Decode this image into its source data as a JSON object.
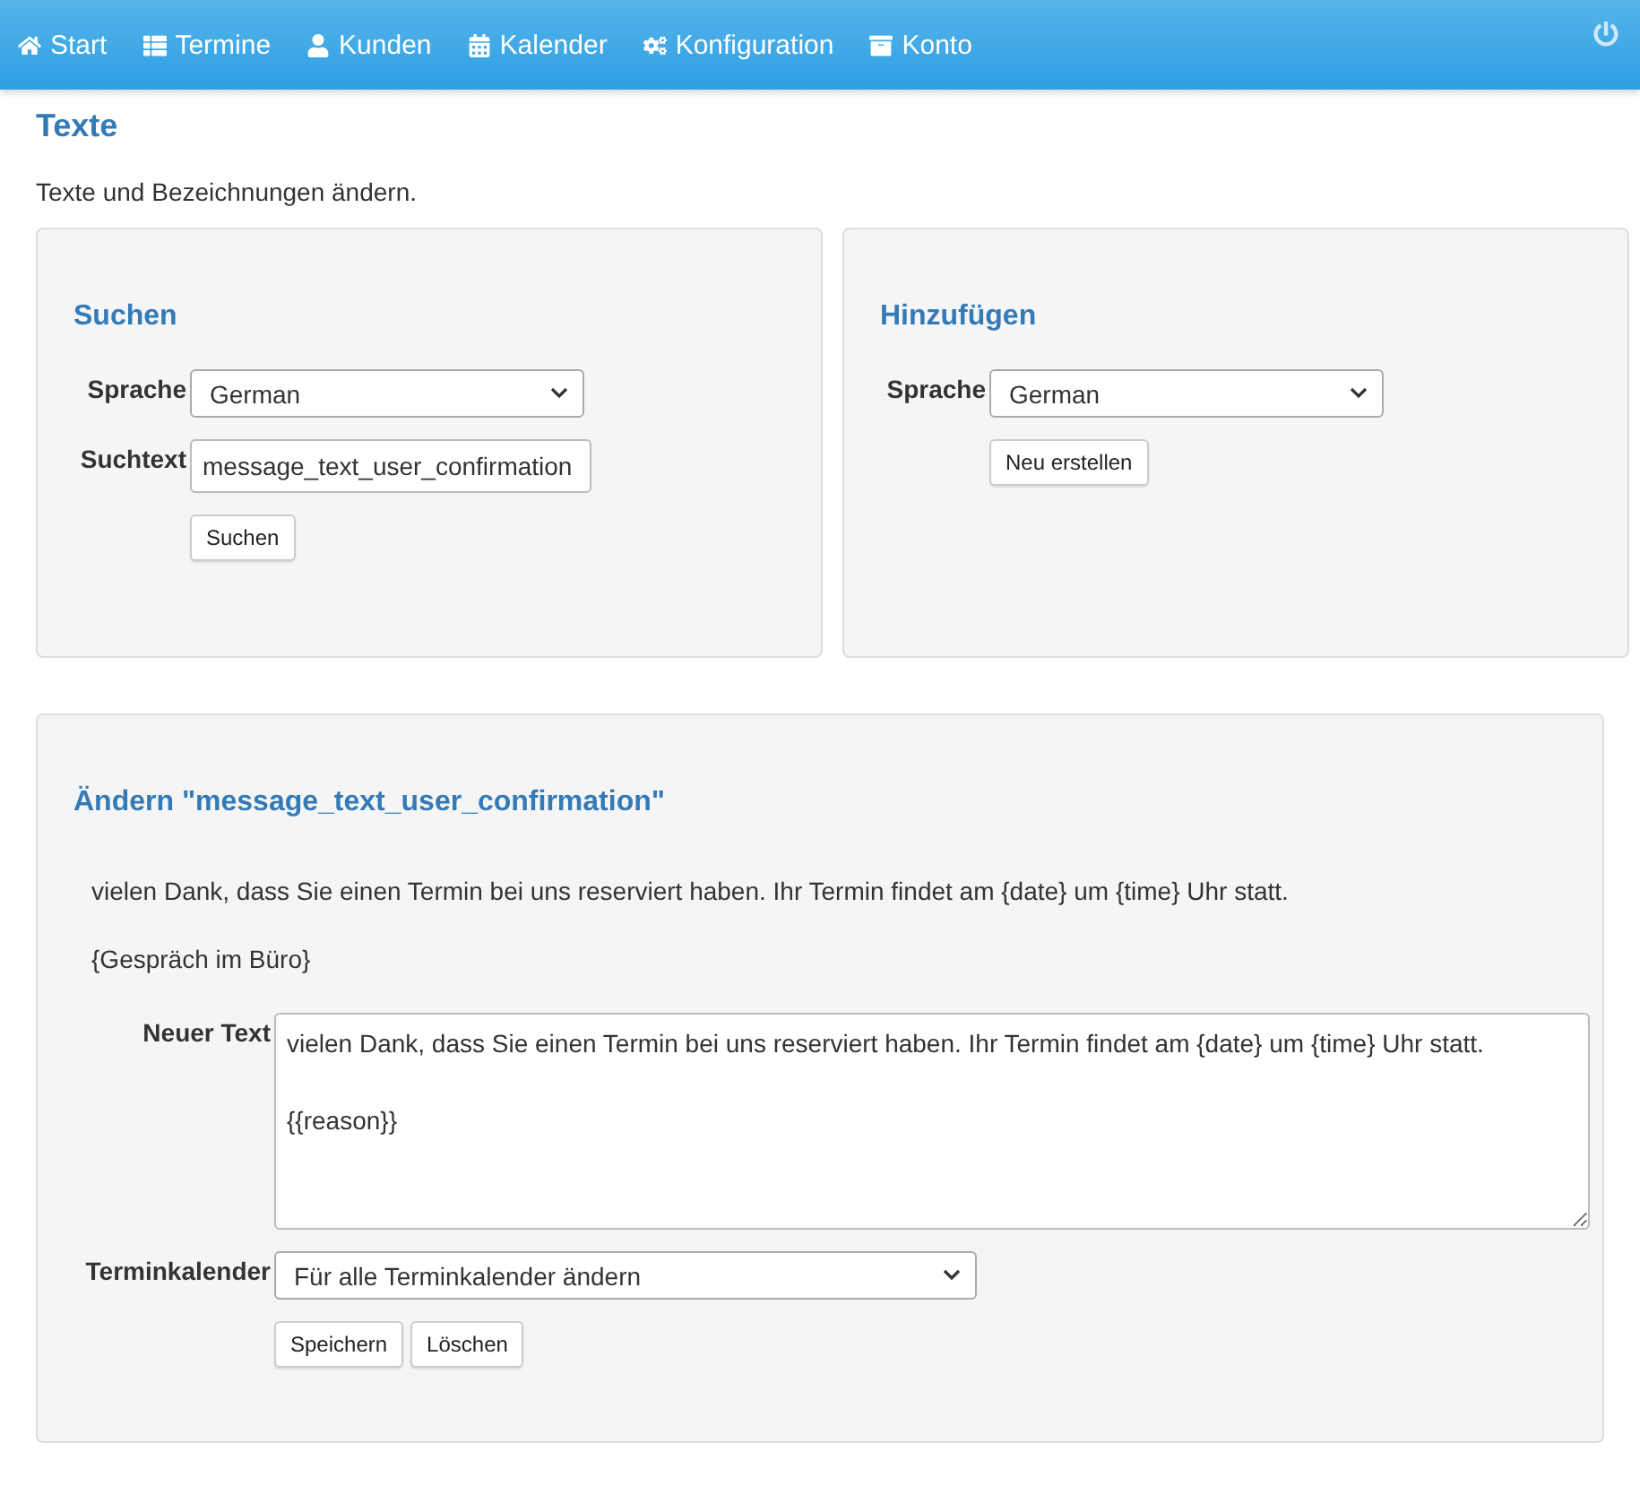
{
  "nav": {
    "items": [
      {
        "kind": "home",
        "label": "Start"
      },
      {
        "kind": "list",
        "label": "Termine"
      },
      {
        "kind": "user",
        "label": "Kunden"
      },
      {
        "kind": "calendar",
        "label": "Kalender"
      },
      {
        "kind": "gears",
        "label": "Konfiguration"
      },
      {
        "kind": "archive",
        "label": "Konto"
      }
    ]
  },
  "page": {
    "title": "Texte",
    "description": "Texte und Bezeichnungen ändern."
  },
  "search_panel": {
    "title": "Suchen",
    "language_label": "Sprache",
    "language": "German",
    "search_label": "Suchtext",
    "search_value": "message_text_user_confirmation",
    "button": "Suchen"
  },
  "add_panel": {
    "title": "Hinzufügen",
    "language_label": "Sprache",
    "language": "German",
    "button": "Neu erstellen"
  },
  "edit_panel": {
    "title": "Ändern \"message_text_user_confirmation\"",
    "current_text": "vielen Dank, dass Sie einen Termin bei uns reserviert haben. Ihr Termin findet am {date} um {time} Uhr statt.",
    "current_reason": "{Gespräch im Büro}",
    "new_text_label": "Neuer Text",
    "new_text": "vielen Dank, dass Sie einen Termin bei uns reserviert haben. Ihr Termin findet am {date} um {time} Uhr statt.\n\n{{reason}}",
    "calendar_label": "Terminkalender",
    "calendar": "Für alle Terminkalender ändern",
    "buttons": [
      "Speichern",
      "Löschen"
    ]
  }
}
